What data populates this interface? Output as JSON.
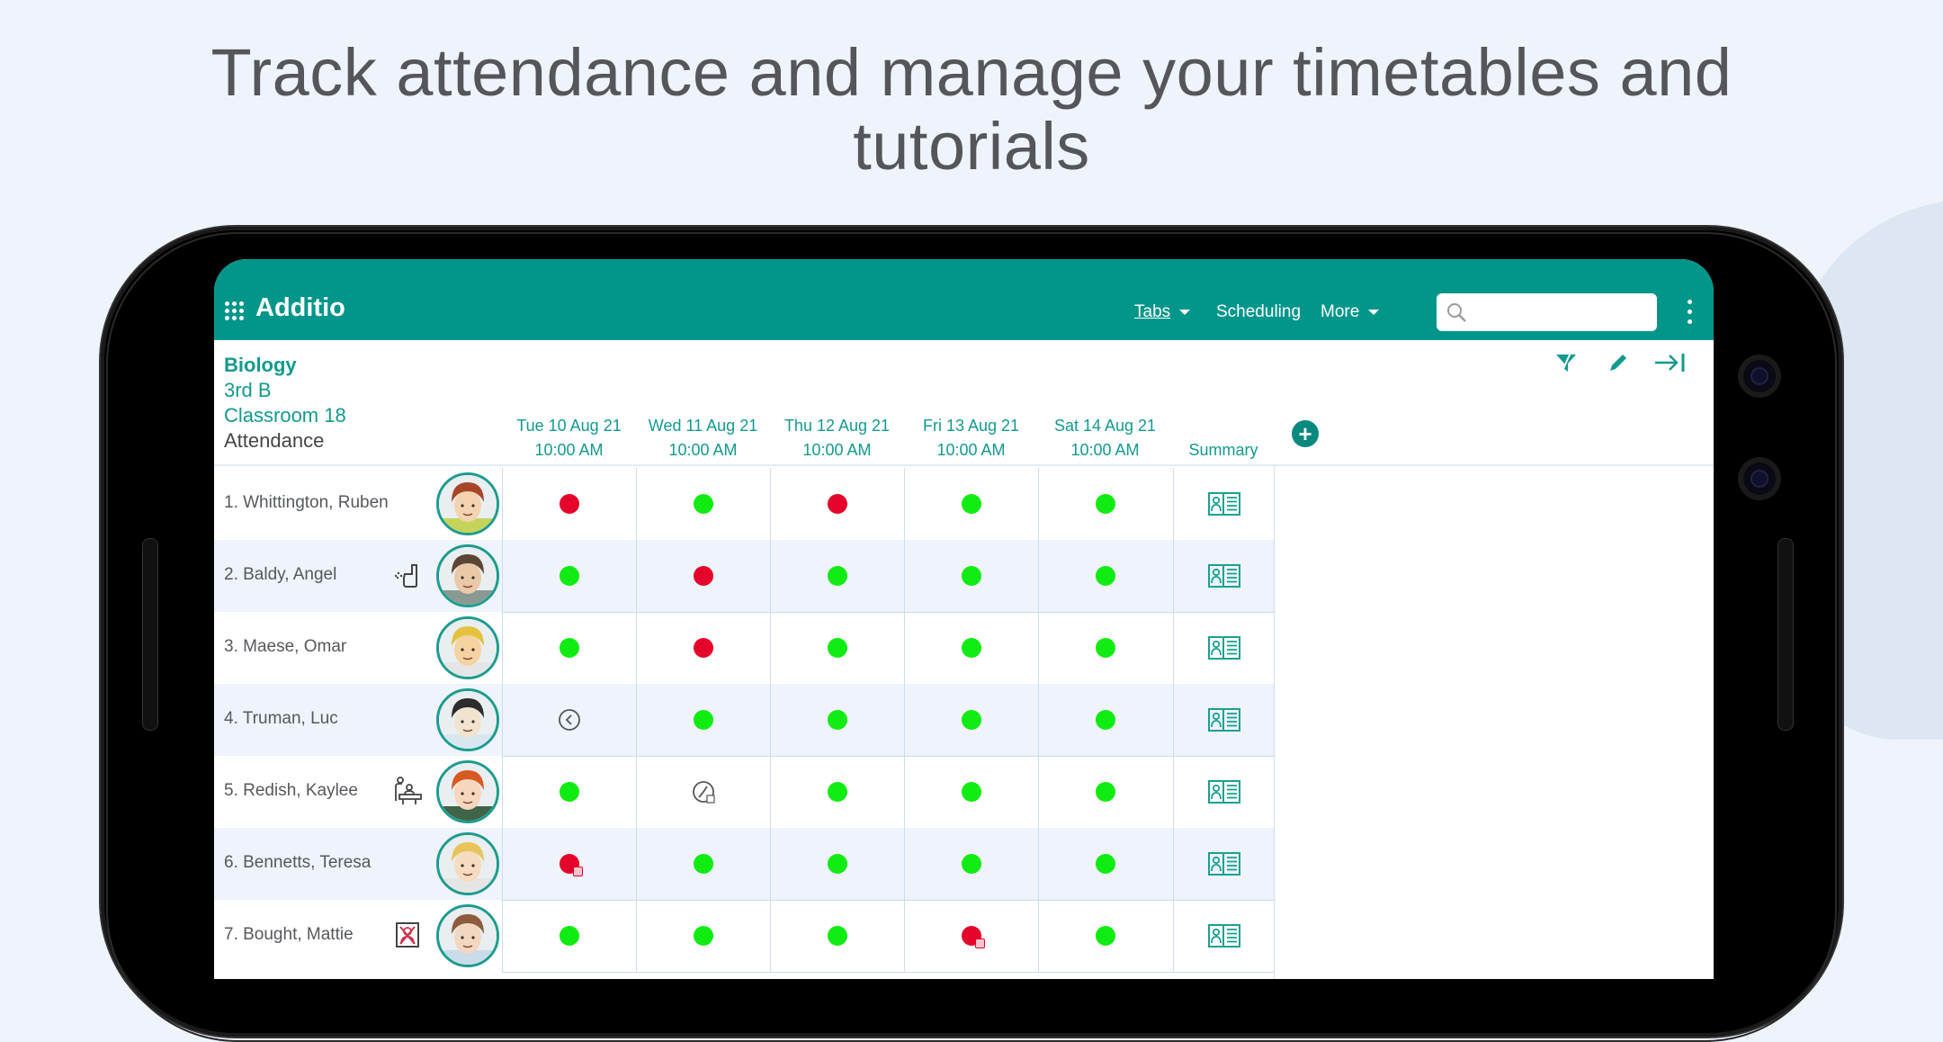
{
  "headline": {
    "line1": "Track attendance and manage your timetables and",
    "line2": "tutorials"
  },
  "appbar": {
    "brand": "Additio",
    "nav": [
      {
        "label": "Tabs",
        "dropdown": true,
        "underlined": true
      },
      {
        "label": "Scheduling",
        "dropdown": false
      },
      {
        "label": "More",
        "dropdown": true
      }
    ],
    "search": {
      "value": "",
      "placeholder": ""
    }
  },
  "colors": {
    "accent": "#02968b",
    "present": "#10ec11",
    "absent": "#e5042a",
    "text_teal": "#129a8e"
  },
  "class_info": {
    "subject": "Biology",
    "group": "3rd B",
    "room": "Classroom 18",
    "view": "Attendance"
  },
  "toolbar": [
    "filter-icon",
    "edit-pencil-icon",
    "collapse-right-icon"
  ],
  "columns": [
    {
      "date": "Tue 10 Aug 21",
      "time": "10:00 AM"
    },
    {
      "date": "Wed 11 Aug 21",
      "time": "10:00 AM"
    },
    {
      "date": "Thu 12 Aug 21",
      "time": "10:00 AM"
    },
    {
      "date": "Fri 13 Aug 21",
      "time": "10:00 AM"
    },
    {
      "date": "Sat 14 Aug 21",
      "time": "10:00 AM"
    }
  ],
  "summary_label": "Summary",
  "students": [
    {
      "name": "1. Whittington, Ruben",
      "flag": null,
      "attendance": [
        "absent",
        "present",
        "absent",
        "present",
        "present"
      ]
    },
    {
      "name": "2. Baldy, Angel",
      "flag": "inhaler-icon",
      "attendance": [
        "present",
        "absent",
        "present",
        "present",
        "present"
      ]
    },
    {
      "name": "3. Maese, Omar",
      "flag": null,
      "attendance": [
        "present",
        "absent",
        "present",
        "present",
        "present"
      ]
    },
    {
      "name": "4. Truman, Luc",
      "flag": null,
      "attendance": [
        "early-leave",
        "present",
        "present",
        "present",
        "present"
      ]
    },
    {
      "name": "5. Redish, Kaylee",
      "flag": "tutoring-icon",
      "attendance": [
        "present",
        "late-with-note",
        "present",
        "present",
        "present"
      ]
    },
    {
      "name": "6. Bennetts, Teresa",
      "flag": null,
      "attendance": [
        "absent-with-note",
        "present",
        "present",
        "present",
        "present"
      ]
    },
    {
      "name": "7. Bought, Mattie",
      "flag": "no-photo-icon",
      "attendance": [
        "present",
        "present",
        "present",
        "absent-with-note",
        "present"
      ]
    }
  ]
}
